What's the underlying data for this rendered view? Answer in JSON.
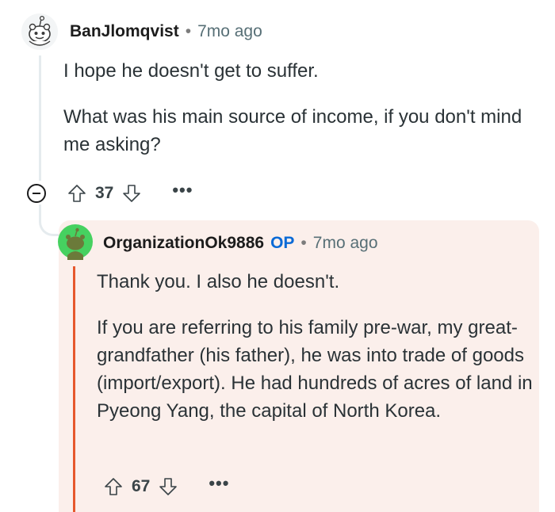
{
  "parent": {
    "username": "BanJlomqvist",
    "separator": "•",
    "time": "7mo ago",
    "paragraphs": [
      "I hope he doesn't get to suffer.",
      "What was his main source of income, if you don't mind me asking?"
    ],
    "score": "37",
    "avatar_icon": "snoo-avatar-icon"
  },
  "reply": {
    "username": "OrganizationOk9886",
    "op_badge": "OP",
    "separator": "•",
    "time": "7mo ago",
    "paragraphs": [
      "Thank you. I also he doesn't.",
      "If you are referring to his family pre-war, my great-grandfather (his father), he was into trade of goods (import/export). He had hundreds of acres of land in Pyeong Yang, the capital of North Korea."
    ],
    "score": "67",
    "avatar_icon": "snoo-avatar-icon",
    "highlight_color": "#fbefeb",
    "thread_color": "#e6582d"
  },
  "more_label": "•••",
  "colors": {
    "op": "#0a6ad6",
    "meta": "#576f76",
    "avatar_green": "#46d160"
  }
}
